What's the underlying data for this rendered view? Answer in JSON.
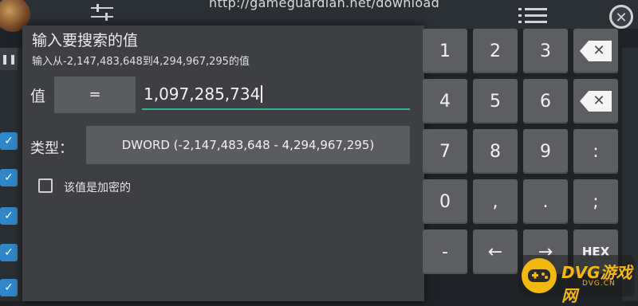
{
  "background": {
    "url_text": "http://gameguardian.net/download",
    "close_glyph": "✕",
    "check_glyph": "✓",
    "pause_glyph": "❚❚"
  },
  "dialog": {
    "title": "输入要搜索的值",
    "hint": "输入从-2,147,483,648到4,294,967,295的值",
    "value_label": "值",
    "operator": "=",
    "value": "1,097,285,734",
    "type_label": "类型：",
    "type_value": "DWORD (-2,147,483,648 - 4,294,967,295)",
    "encrypted_label": "该值是加密的",
    "encrypted_checked": false
  },
  "keypad": {
    "keys": [
      "1",
      "2",
      "3",
      "4",
      "5",
      "6",
      "7",
      "8",
      "9",
      ":",
      "0",
      ",",
      ".",
      ";",
      "-",
      "←",
      "→",
      "HEX"
    ],
    "backspace_icon": "backspace-icon",
    "clear_icon": "clear-icon"
  },
  "watermark": {
    "text": "DVG游戏网",
    "subtext": "DVG.CN",
    "color": "#f2b80f"
  },
  "colors": {
    "accent": "#30b39a",
    "dialog_bg": "#3d3f42",
    "key_bg": "#5c5e61"
  }
}
